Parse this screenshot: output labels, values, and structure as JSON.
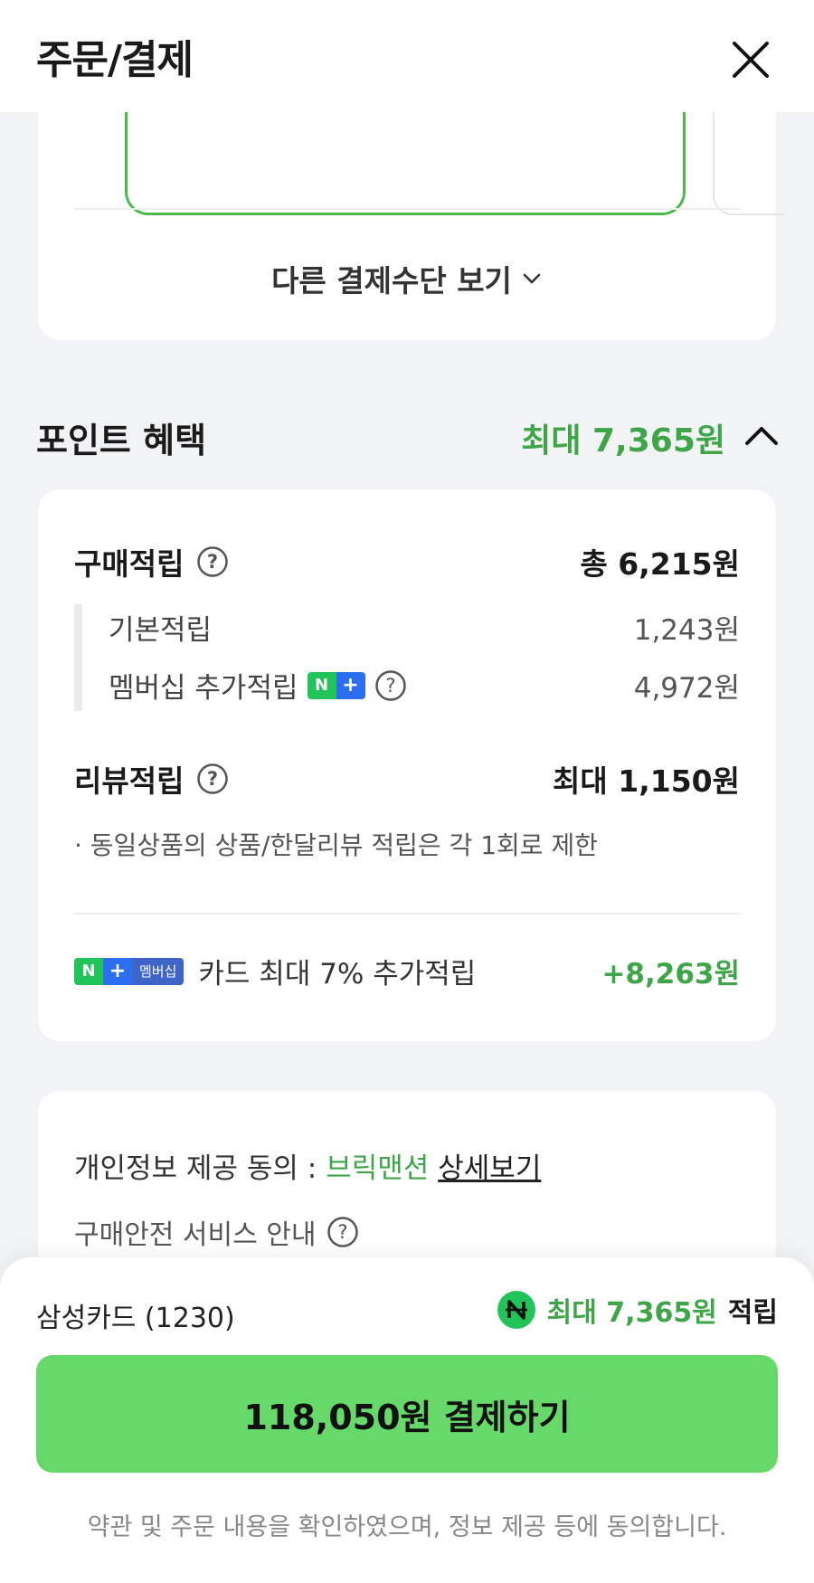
{
  "header": {
    "title": "주문/결제",
    "close_icon": "close-icon"
  },
  "payment_methods": {
    "other_methods_label": "다른 결제수단 보기"
  },
  "points": {
    "section_title": "포인트 혜택",
    "max_total": "최대 7,365원",
    "purchase": {
      "label": "구매적립",
      "value": "총 6,215원",
      "items": [
        {
          "label": "기본적립",
          "value": "1,243원"
        },
        {
          "label": "멤버십 추가적립",
          "value": "4,972원"
        }
      ]
    },
    "review": {
      "label": "리뷰적립",
      "value": "최대 1,150원",
      "note": "· 동일상품의 상품/한달리뷰 적립은 각 1회로 제한"
    },
    "card_bonus": {
      "badge_n": "N",
      "badge_plus": "+",
      "badge_membership": "멤버십",
      "label": "카드 최대 7% 추가적립",
      "value": "+8,263원"
    }
  },
  "agreements": {
    "privacy_label": "개인정보 제공 동의 :",
    "brand": "브릭맨션",
    "detail_link": "상세보기",
    "safety_label": "구매안전 서비스 안내"
  },
  "bottom_bar": {
    "card_name": "삼성카드 (1230)",
    "reward_amount": "최대 7,365원",
    "reward_suffix": "적립",
    "pay_button_label": "118,050원 결제하기",
    "terms_text": "약관 및 주문 내용을 확인하였으며, 정보 제공 등에 동의합니다."
  },
  "colors": {
    "accent_green": "#3ea548",
    "button_green": "#66d96a",
    "npay_green": "#21c458"
  }
}
